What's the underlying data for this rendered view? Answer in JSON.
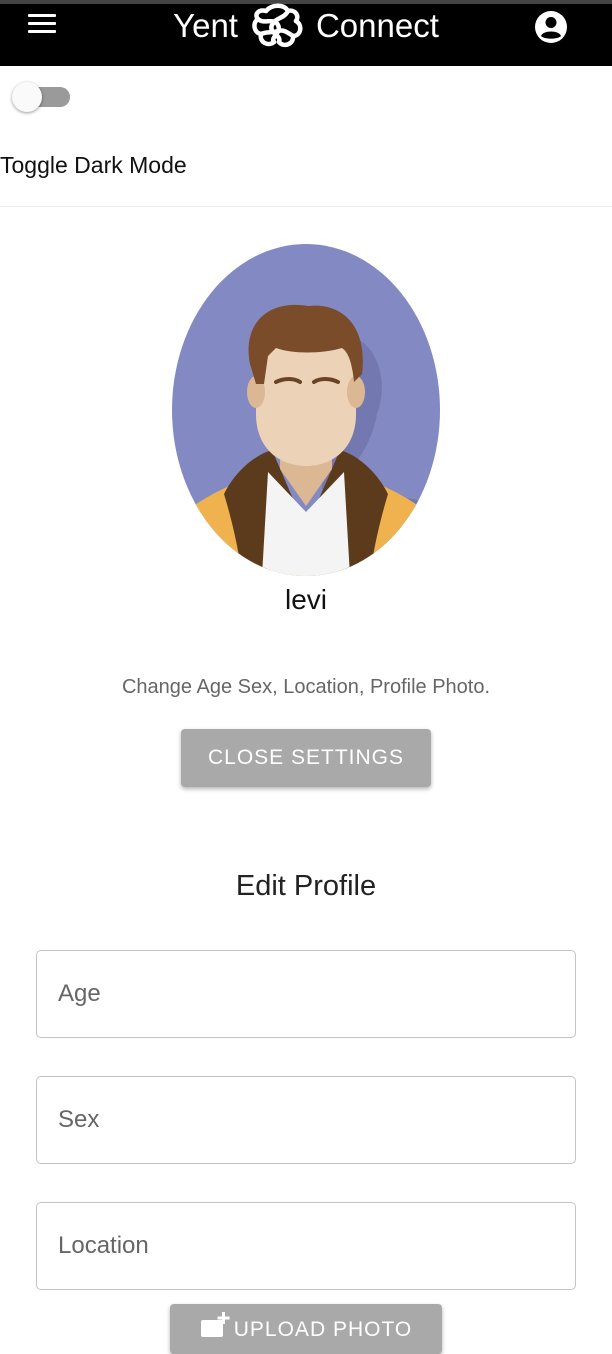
{
  "header": {
    "brand_left": "Yent",
    "brand_right": "Connect",
    "logo_icon": "knot-logo-icon",
    "menu_icon": "hamburger-menu-icon",
    "account_icon": "account-circle-icon",
    "background_color": "#000000"
  },
  "theme_toggle": {
    "label": "Toggle Dark Mode",
    "checked": false
  },
  "profile": {
    "name": "levi",
    "settings_note": "Change Age Sex, Location, Profile Photo.",
    "close_settings_label": "CLOSE SETTINGS",
    "avatar_background": "#8389c2"
  },
  "edit_profile": {
    "title": "Edit Profile",
    "fields": {
      "age": {
        "placeholder": "Age",
        "value": ""
      },
      "sex": {
        "placeholder": "Sex",
        "value": ""
      },
      "location": {
        "placeholder": "Location",
        "value": ""
      }
    },
    "upload_label": "UPLOAD PHOTO",
    "upload_icon": "add-photo-icon"
  },
  "colors": {
    "button_bg": "#a9a9a9",
    "button_text": "#ffffff"
  }
}
